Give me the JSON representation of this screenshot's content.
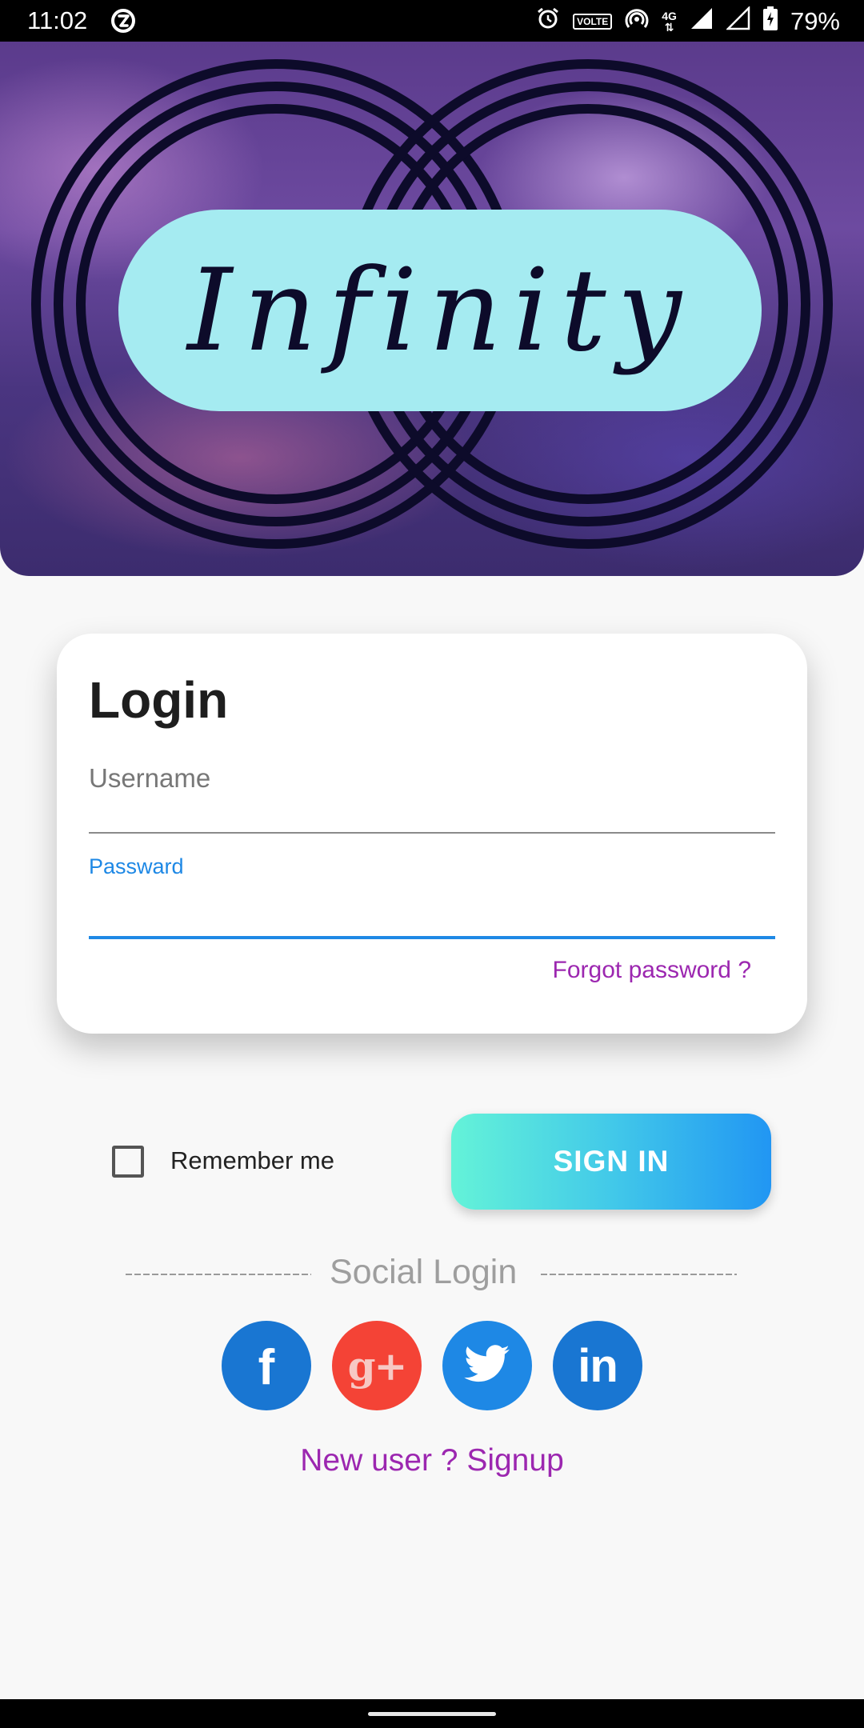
{
  "status_bar": {
    "time": "11:02",
    "battery": "79%",
    "volte_label": "VOLTE",
    "network_label": "4G",
    "icons": [
      "do-not-disturb-icon",
      "alarm-icon",
      "volte-icon",
      "hotspot-icon",
      "4g-data-icon",
      "signal-full-icon",
      "signal-empty-icon",
      "battery-charging-icon"
    ]
  },
  "banner": {
    "logo_text": "Infinity",
    "colors": {
      "pill": "#a5ebf1",
      "rings": "#0d0b2a"
    }
  },
  "login_card": {
    "title": "Login",
    "username_placeholder": "Username",
    "password_label": "Passward",
    "forgot_password": "Forgot password ?"
  },
  "remember_me": {
    "label": "Remember me",
    "checked": false
  },
  "sign_in": {
    "label": "SIGN IN"
  },
  "social": {
    "title": "Social Login",
    "buttons": [
      {
        "name": "facebook",
        "glyph": "f",
        "color": "#1976d2"
      },
      {
        "name": "google-plus",
        "glyph": "g+",
        "color": "#f44336"
      },
      {
        "name": "twitter",
        "glyph": "twitter-bird",
        "color": "#1e88e5"
      },
      {
        "name": "linkedin",
        "glyph": "in",
        "color": "#1976d2"
      }
    ]
  },
  "signup": {
    "label": "New user ? Signup"
  },
  "theme": {
    "accent_purple": "#9c27b0",
    "accent_blue": "#1e88e5",
    "sign_in_gradient": [
      "#64f3d8",
      "#2196f3"
    ]
  }
}
